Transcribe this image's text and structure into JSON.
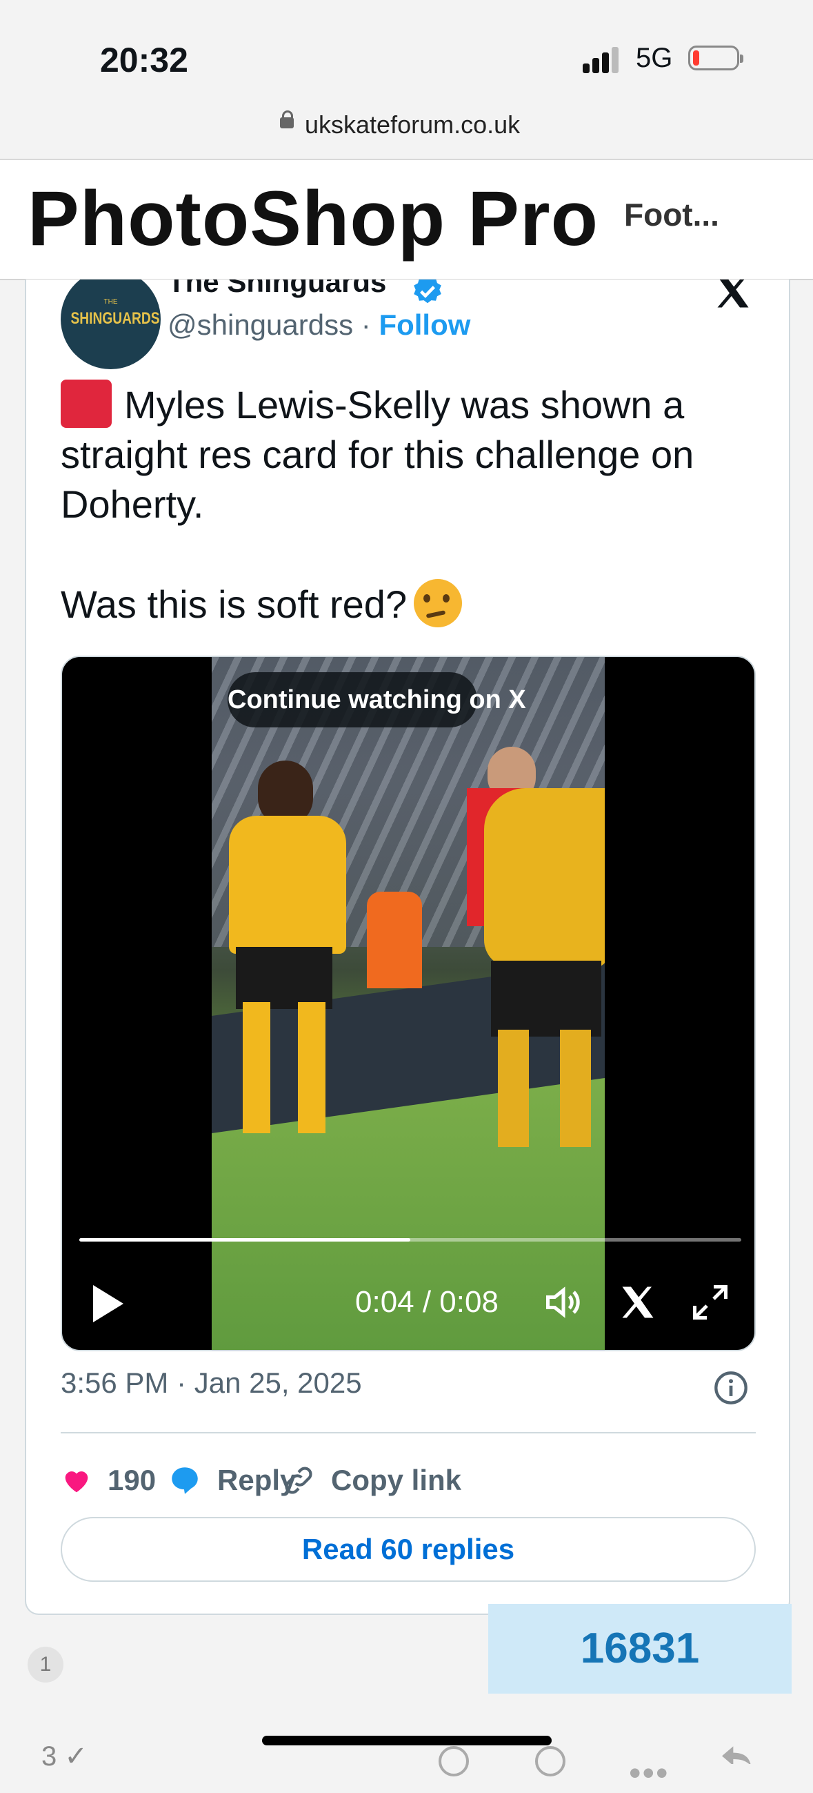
{
  "status": {
    "time": "20:32",
    "network": "5G",
    "battery_level": 0.15,
    "battery_color": "#ff3b30"
  },
  "browser": {
    "url": "ukskateforum.co.uk"
  },
  "site": {
    "logo": "PhotoShop Pro",
    "nav_item": "Foot..."
  },
  "tweet": {
    "author_name": "The Shinguards",
    "avatar_small": "THE",
    "avatar_text": "SHINGUARDS",
    "handle": "@shinguardss",
    "separator": "·",
    "follow_label": "Follow",
    "text_line1": "Myles Lewis-Skelly was shown a straight res card for this challenge on Doherty.",
    "text_line2": "Was this is soft red?",
    "icons": [
      "verified-badge-icon",
      "x-logo-icon",
      "red-card-emoji",
      "thinking-face-emoji"
    ],
    "video": {
      "overlay_label": "Continue watching on X",
      "current_time": "0:04",
      "duration": "0:08",
      "time_display": "0:04 / 0:08",
      "progress": 0.5,
      "icons": [
        "play-icon",
        "volume-icon",
        "x-icon",
        "fullscreen-icon"
      ]
    },
    "timestamp": "3:56 PM · Jan 25, 2025",
    "likes": "190",
    "reply_label": "Reply",
    "copy_link_label": "Copy link",
    "read_replies_label": "Read 60 replies",
    "accent_color": "#1d9bf0",
    "like_color": "#f91880"
  },
  "forum": {
    "post_number": "1",
    "counter": "16831",
    "bottom_text": "3 ✓"
  }
}
